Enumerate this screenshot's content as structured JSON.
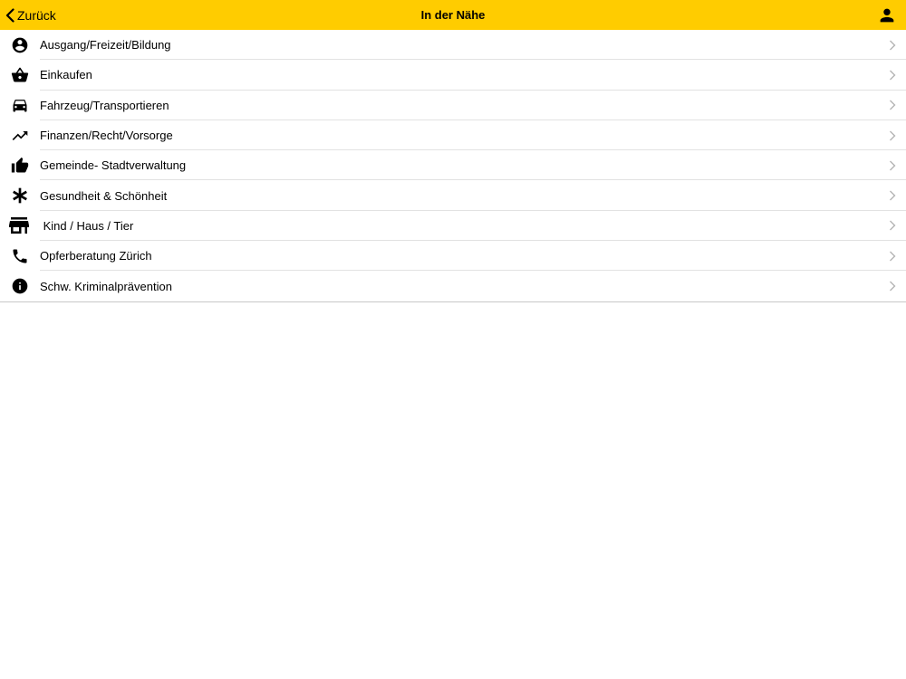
{
  "navbar": {
    "back_label": "Zurück",
    "title": "In der Nähe",
    "background": "#ffcc00",
    "back_icon": "chevron-left-icon",
    "profile_icon": "person-icon"
  },
  "items": [
    {
      "label": "Ausgang/Freizeit/Bildung",
      "icon": "account-circle-icon"
    },
    {
      "label": "Einkaufen",
      "icon": "shopping-basket-icon"
    },
    {
      "label": "Fahrzeug/Transportieren",
      "icon": "car-icon"
    },
    {
      "label": "Finanzen/Recht/Vorsorge",
      "icon": "trending-up-icon"
    },
    {
      "label": "Gemeinde- Stadtverwaltung",
      "icon": "thumbs-up-icon"
    },
    {
      "label": "Gesundheit & Schönheit",
      "icon": "asterisk-icon"
    },
    {
      "label": " Kind / Haus / Tier",
      "icon": "store-icon"
    },
    {
      "label": "Opferberatung Zürich",
      "icon": "phone-icon"
    },
    {
      "label": "Schw. Kriminalprävention",
      "icon": "info-icon"
    }
  ]
}
